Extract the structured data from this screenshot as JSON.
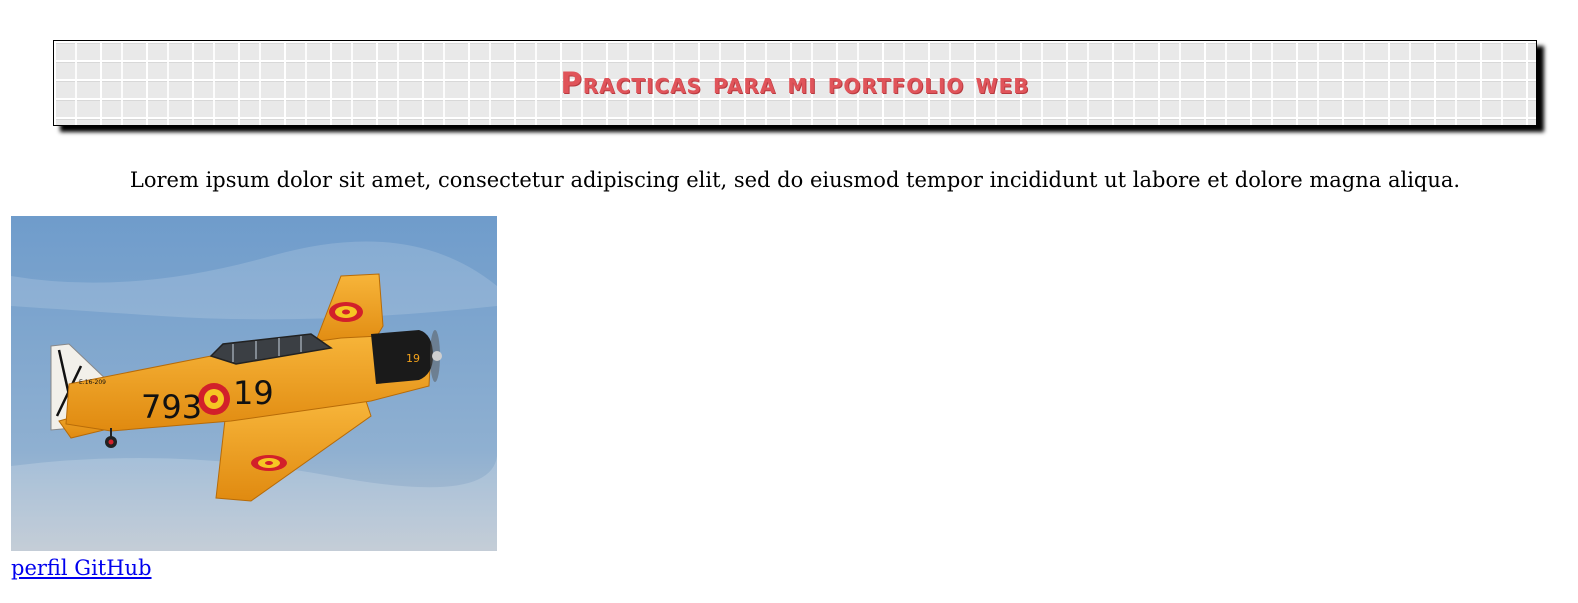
{
  "header": {
    "title": "Practicas para mi portfolio web"
  },
  "main": {
    "intro_text": "Lorem ipsum dolor sit amet, consectetur adipiscing elit, sed do eiusmod tempor incididunt ut labore et dolore magna aliqua.",
    "photo": {
      "plane_number": "793",
      "plane_number_suffix": "19",
      "nose_number": "19",
      "tail_code": "E.16-209",
      "colors": {
        "sky_top": "#6f9ccb",
        "sky_bottom": "#b8c3cf",
        "fuselage": "#f2a21c",
        "roundel_red": "#d2202a",
        "roundel_yellow": "#f6c623"
      }
    },
    "github_link_label": "perfil GitHub"
  }
}
